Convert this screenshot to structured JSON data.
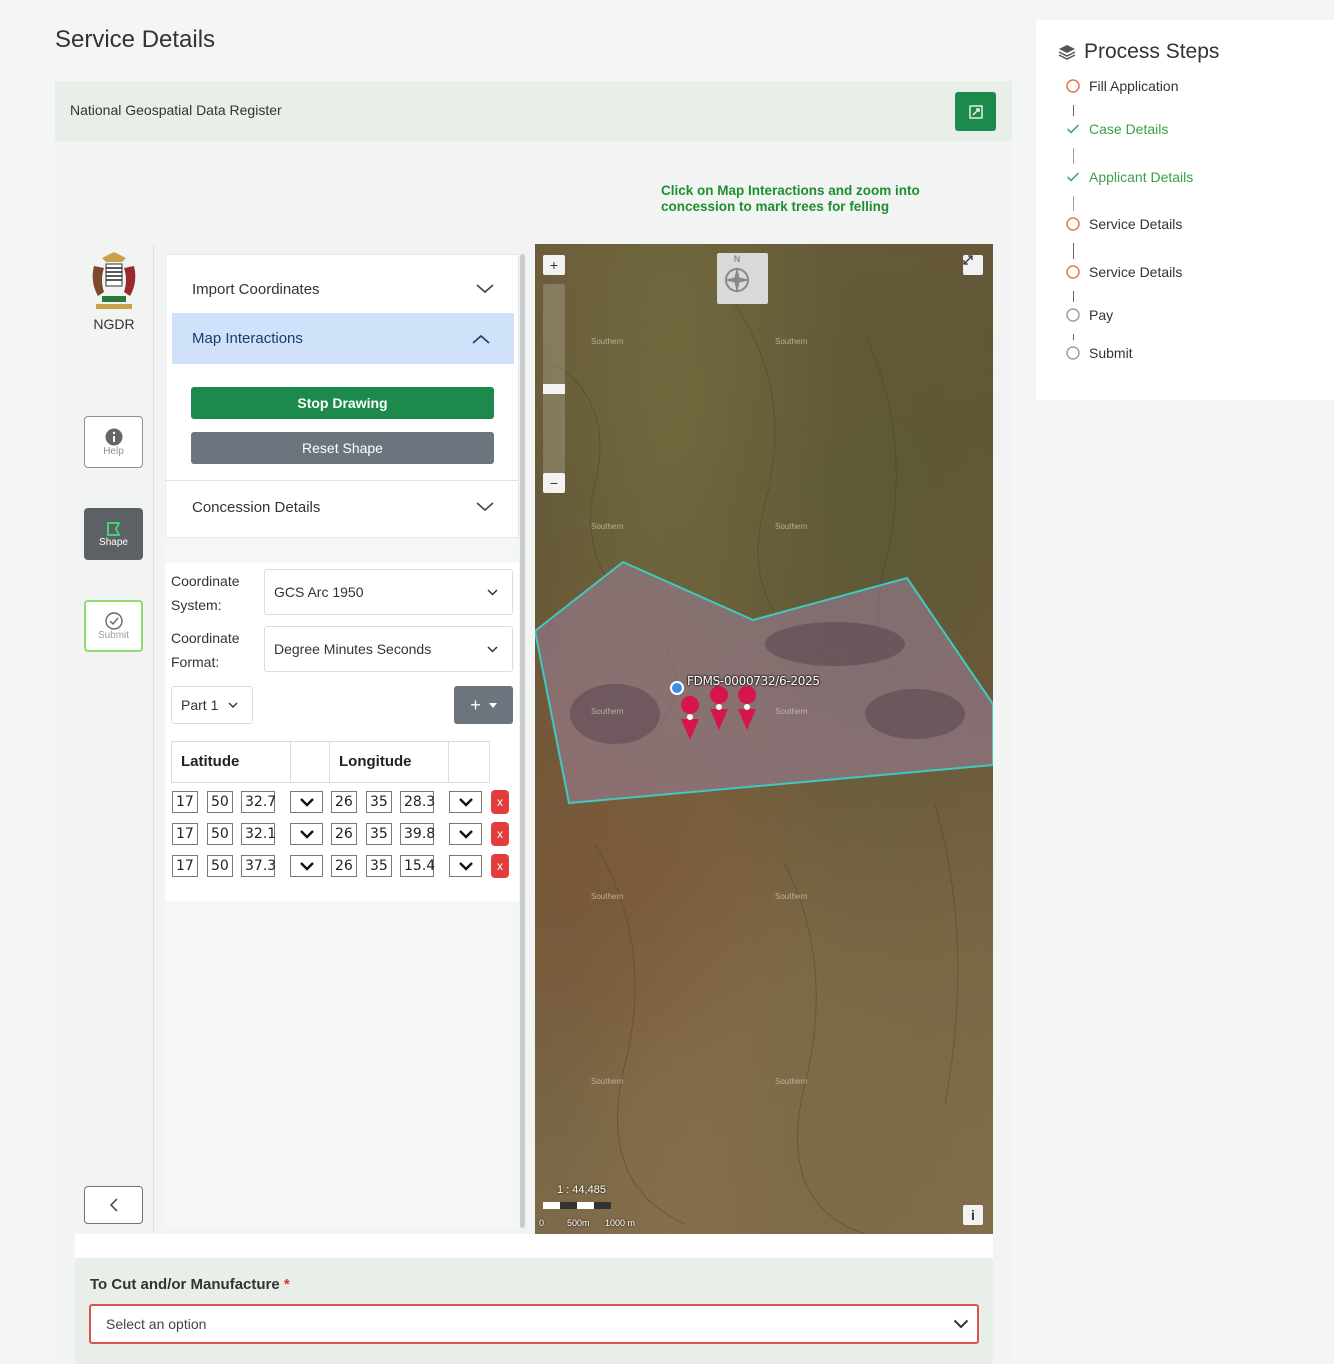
{
  "page": {
    "title": "Service Details"
  },
  "header": {
    "title": "National Geospatial Data Register"
  },
  "hint": {
    "text": "Click on Map Interactions and zoom into concession to mark trees for felling"
  },
  "rail": {
    "logo_label": "NGDR",
    "help_label": "Help",
    "shape_label": "Shape",
    "submit_label": "Submit"
  },
  "accordion": {
    "import_coordinates": "Import Coordinates",
    "map_interactions": "Map Interactions",
    "stop_drawing": "Stop Drawing",
    "reset_shape": "Reset Shape",
    "concession_details": "Concession Details"
  },
  "coords": {
    "system_label_1": "Coordinate",
    "system_label_2": "System:",
    "system_value": "GCS Arc 1950",
    "format_label_1": "Coordinate",
    "format_label_2": "Format:",
    "format_value": "Degree Minutes Seconds",
    "part_value": "Part 1",
    "plus_label": "+",
    "latitude_header": "Latitude",
    "longitude_header": "Longitude",
    "rows": [
      {
        "lat_d": "17",
        "lat_m": "50",
        "lat_s": "32.7",
        "lon_d": "26",
        "lon_m": "35",
        "lon_s": "28.3"
      },
      {
        "lat_d": "17",
        "lat_m": "50",
        "lat_s": "32.1",
        "lon_d": "26",
        "lon_m": "35",
        "lon_s": "39.8"
      },
      {
        "lat_d": "17",
        "lat_m": "50",
        "lat_s": "37.3",
        "lon_d": "26",
        "lon_m": "35",
        "lon_s": "15.4"
      }
    ],
    "delete_label": "x"
  },
  "map": {
    "compass_label": "N",
    "zoom_in": "+",
    "zoom_out": "−",
    "region_label": "Southern",
    "feature_label": "FDMS-0000732/6-2025",
    "scale_ratio": "1 : 44,485",
    "scale_0": "0",
    "scale_500": "500m",
    "scale_1000": "1000 m",
    "info": "i",
    "polygon_color": "#3fc9c0",
    "marker_color": "#d6154a"
  },
  "bottom": {
    "label": "To Cut and/or Manufacture",
    "required": "*",
    "placeholder": "Select an option"
  },
  "steps": {
    "title": "Process Steps",
    "items": [
      {
        "label": "Fill Application",
        "state": "current"
      },
      {
        "label": "Case Details",
        "state": "done"
      },
      {
        "label": "Applicant Details",
        "state": "done"
      },
      {
        "label": "Service Details",
        "state": "current"
      },
      {
        "label": "Service Details",
        "state": "current"
      },
      {
        "label": "Pay",
        "state": "pending"
      },
      {
        "label": "Submit",
        "state": "pending"
      }
    ]
  },
  "colors": {
    "brand_green": "#1c8a4c",
    "accent_blue": "#cfe2fa",
    "danger": "#e43c3c",
    "step_orange": "#e8754a"
  }
}
